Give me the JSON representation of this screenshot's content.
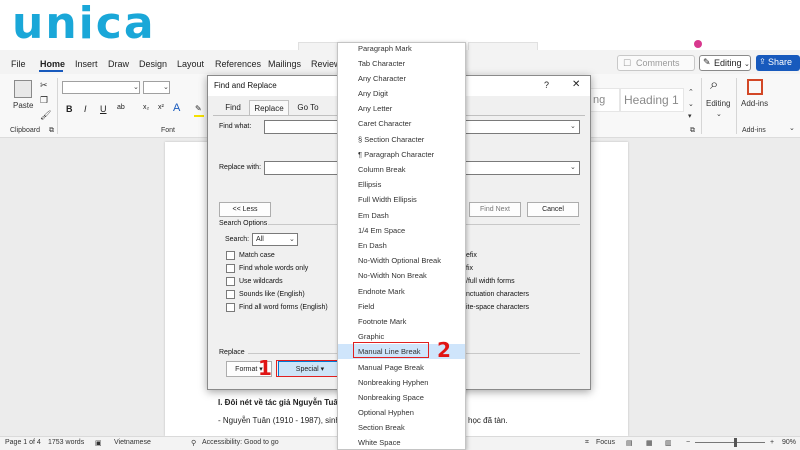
{
  "brand": {
    "logo": "unica"
  },
  "menubar": {
    "items": [
      "File",
      "Home",
      "Insert",
      "Draw",
      "Design",
      "Layout",
      "References",
      "Mailings",
      "Review"
    ],
    "comments": "Comments",
    "editing": "Editing",
    "share": "Share"
  },
  "ribbon": {
    "paste": "Paste",
    "clipboard": "Clipboard",
    "font_group": "Font",
    "styles": [
      "ng",
      "Heading 1"
    ],
    "editing": "Editing",
    "addins": "Add-ins",
    "addins_group": "Add-ins",
    "bold": "B",
    "italic": "I",
    "underline": "U"
  },
  "document": {
    "heading": "I. Đôi nét về tác giả Nguyễn Tuân",
    "line1_left": "- Nguyễn Tuân (1910 - 1987), sinh r",
    "line1_right": "học đã tàn."
  },
  "statusbar": {
    "page": "Page 1 of 4",
    "words": "1753 words",
    "language": "Vietnamese",
    "accessibility": "Accessibility: Good to go",
    "focus": "Focus",
    "zoom": "90%"
  },
  "dialog": {
    "title": "Find and Replace",
    "help": "?",
    "close": "✕",
    "tabs": [
      "Find",
      "Replace",
      "Go To"
    ],
    "find_what": "Find what:",
    "replace_with": "Replace with:",
    "less": "<< Less",
    "find_next": "Find Next",
    "cancel": "Cancel",
    "search_options": "Search Options",
    "search_label": "Search:",
    "search_value": "All",
    "checkboxes": [
      "Match case",
      "Find whole words only",
      "Use wildcards",
      "Sounds like (English)",
      "Find all word forms (English)"
    ],
    "right_options": [
      "efix",
      "fix",
      "/full width forms",
      "nctuation characters",
      "ite-space characters"
    ],
    "replace_section": "Replace",
    "format": "Format ▾",
    "special": "Special ▾"
  },
  "special_menu": {
    "items": [
      "Paragraph Mark",
      "Tab Character",
      "Any Character",
      "Any Digit",
      "Any Letter",
      "Caret Character",
      "§ Section Character",
      "¶ Paragraph Character",
      "Column Break",
      "Ellipsis",
      "Full Width Ellipsis",
      "Em Dash",
      "1/4 Em Space",
      "En Dash",
      "No-Width Optional Break",
      "No-Width Non Break",
      "Endnote Mark",
      "Field",
      "Footnote Mark",
      "Graphic",
      "Manual Line Break",
      "Manual Page Break",
      "Nonbreaking Hyphen",
      "Nonbreaking Space",
      "Optional Hyphen",
      "Section Break",
      "White Space"
    ],
    "highlighted": "Manual Line Break"
  },
  "annotations": {
    "step1": "1",
    "step2": "2"
  },
  "colors": {
    "accent": "#185abd",
    "logo": "#1aa7d8",
    "marker": "#e01515",
    "highlight": "#cfe5fb"
  }
}
